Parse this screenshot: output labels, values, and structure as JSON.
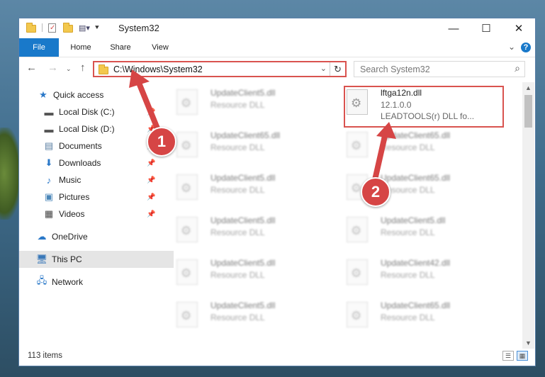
{
  "window": {
    "title": "System32",
    "controls": {
      "minimize": "—",
      "maximize": "☐",
      "close": "✕"
    }
  },
  "ribbon": {
    "tabs": [
      "File",
      "Home",
      "Share",
      "View"
    ],
    "help": "?"
  },
  "address_bar": {
    "path": "C:\\Windows\\System32",
    "search_placeholder": "Search System32"
  },
  "nav_pane": {
    "items": [
      {
        "label": "Quick access",
        "icon": "star-icon",
        "pinned": false
      },
      {
        "label": "Local Disk (C:)",
        "icon": "drive-icon",
        "pinned": true
      },
      {
        "label": "Local Disk (D:)",
        "icon": "drive-icon",
        "pinned": true
      },
      {
        "label": "Documents",
        "icon": "document-icon",
        "pinned": true
      },
      {
        "label": "Downloads",
        "icon": "download-icon",
        "pinned": true
      },
      {
        "label": "Music",
        "icon": "music-icon",
        "pinned": true
      },
      {
        "label": "Pictures",
        "icon": "pictures-icon",
        "pinned": true
      },
      {
        "label": "Videos",
        "icon": "video-icon",
        "pinned": true
      },
      {
        "label": "OneDrive",
        "icon": "cloud-icon",
        "pinned": false
      },
      {
        "label": "This PC",
        "icon": "computer-icon",
        "pinned": false,
        "selected": true
      },
      {
        "label": "Network",
        "icon": "network-icon",
        "pinned": false
      }
    ]
  },
  "files": {
    "left_column": [
      {
        "name": "UpdateClient5.dll",
        "type": "Resource DLL"
      },
      {
        "name": "UpdateClient65.dll",
        "type": "Resource DLL"
      },
      {
        "name": "UpdateClient5.dll",
        "type": "Resource DLL"
      },
      {
        "name": "UpdateClient5.dll",
        "type": "Resource DLL"
      },
      {
        "name": "UpdateClient5.dll",
        "type": "Resource DLL"
      },
      {
        "name": "UpdateClient5.dll",
        "type": "Resource DLL"
      }
    ],
    "highlighted": {
      "name": "lftga12n.dll",
      "version": "12.1.0.0",
      "description": "LEADTOOLS(r) DLL fo..."
    },
    "right_column": [
      {
        "name": "UpdateClient65.dll",
        "type": "Resource DLL"
      },
      {
        "name": "UpdateClient65.dll",
        "type": "Resource DLL"
      },
      {
        "name": "UpdateClient5.dll",
        "type": "Resource DLL"
      },
      {
        "name": "UpdateClient42.dll",
        "type": "Resource DLL"
      },
      {
        "name": "UpdateClient65.dll",
        "type": "Resource DLL"
      }
    ]
  },
  "status_bar": {
    "item_count": "113 items"
  },
  "annotations": {
    "step1": "1",
    "step2": "2"
  },
  "colors": {
    "accent": "#1979ca",
    "annotation_red": "#d64545"
  }
}
